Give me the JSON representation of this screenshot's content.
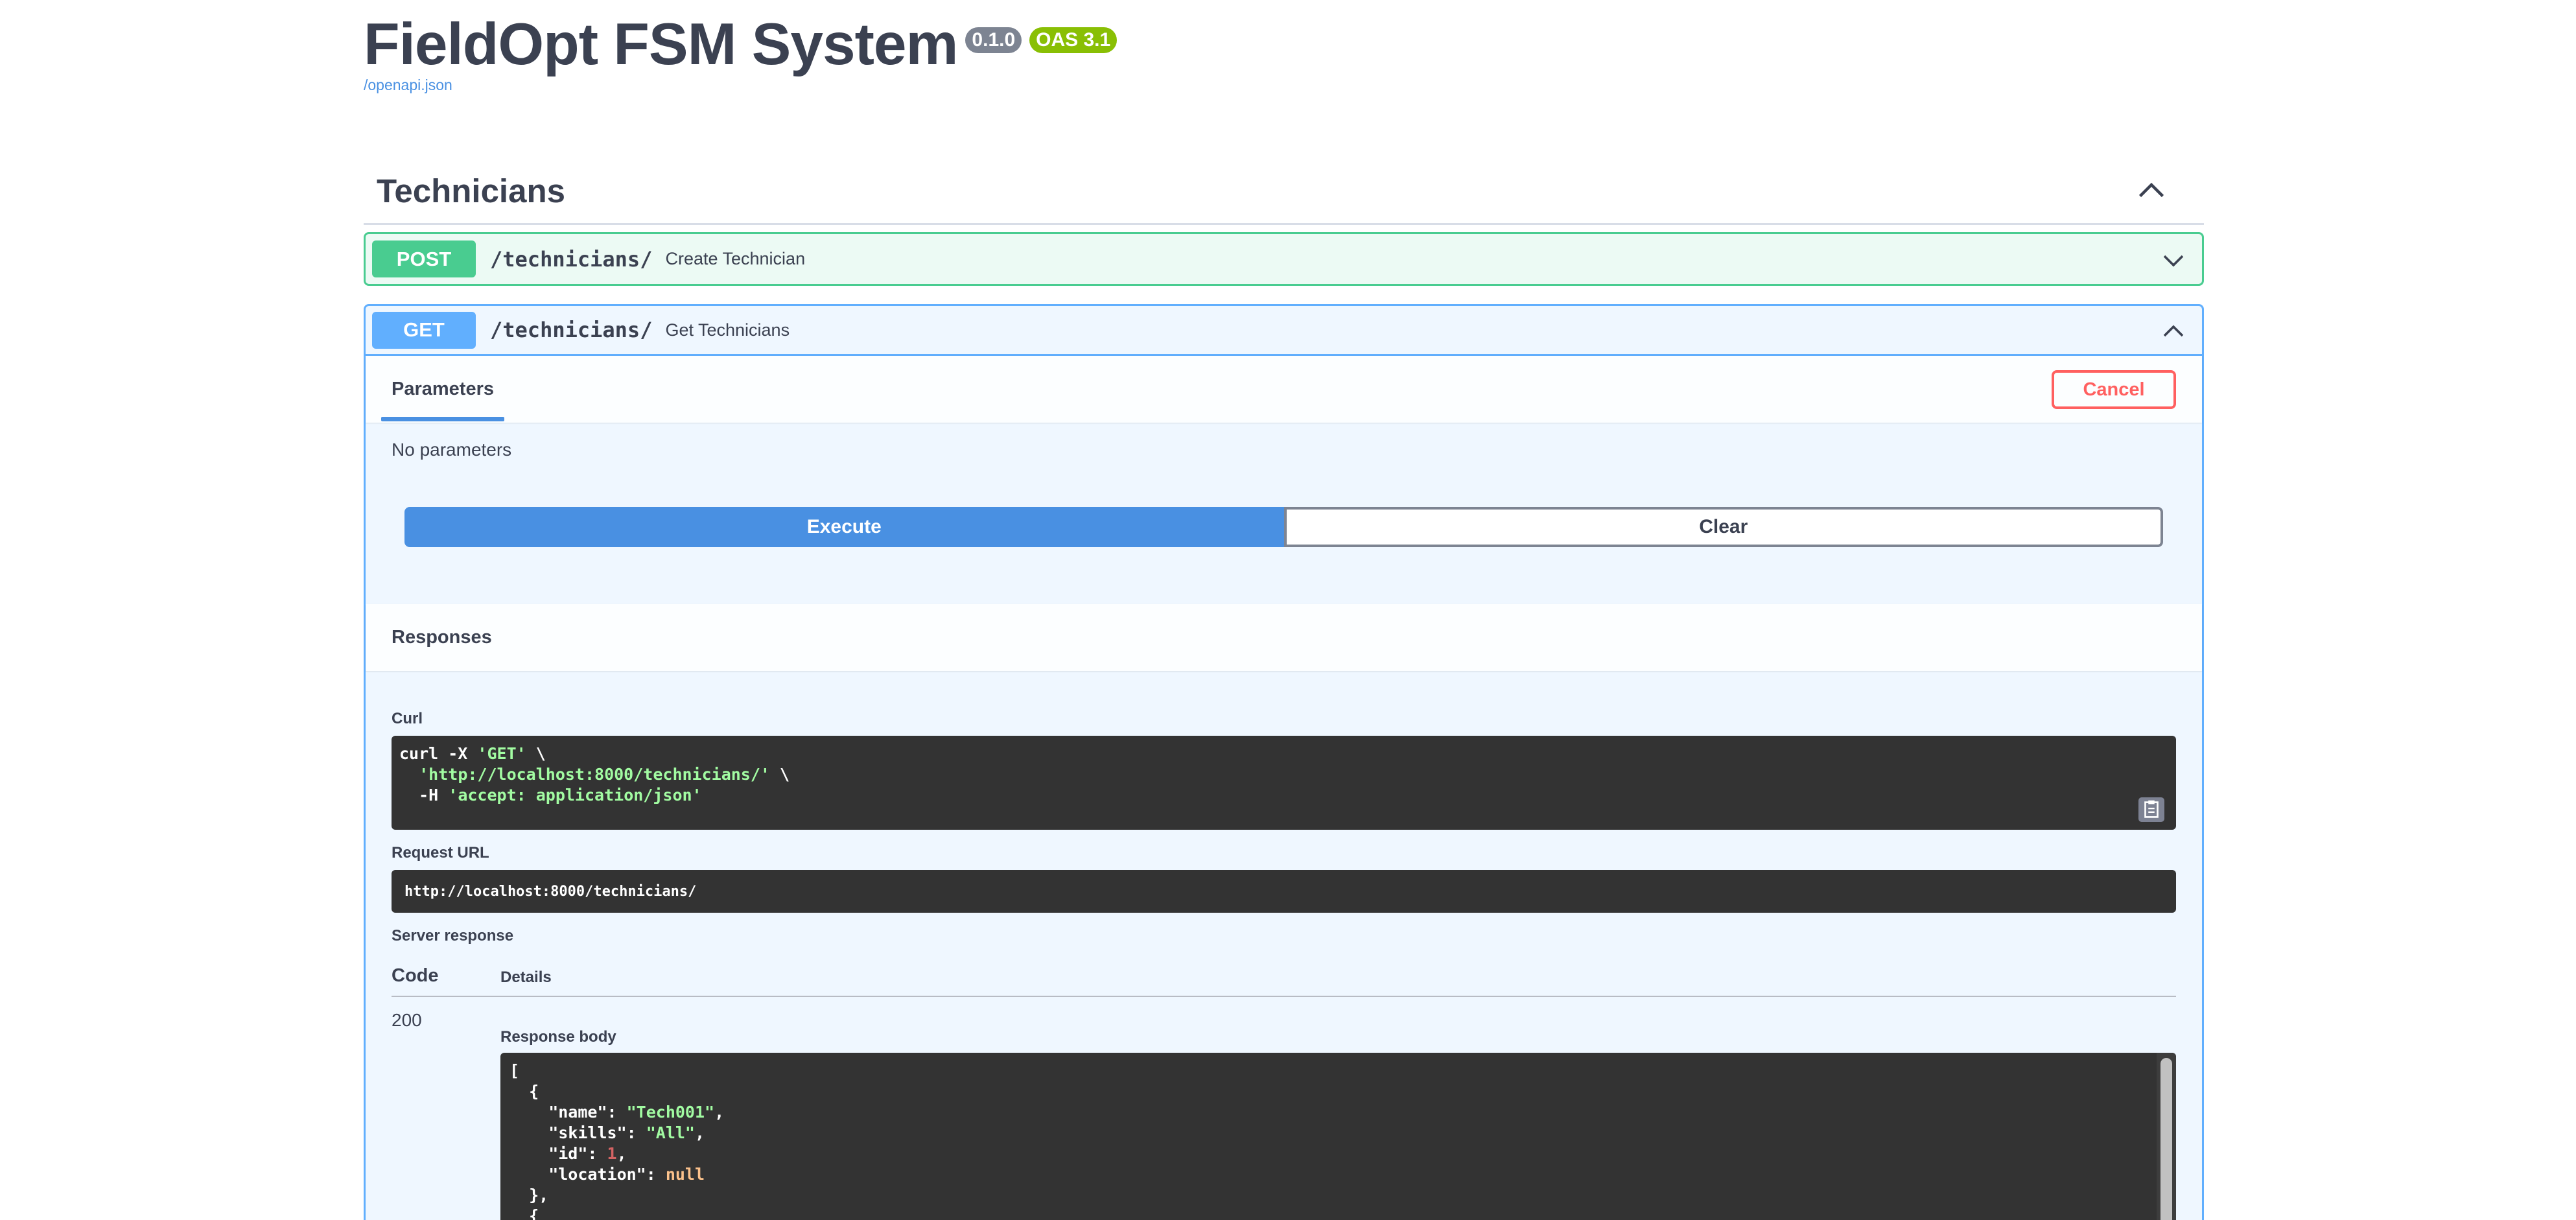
{
  "info": {
    "title": "FieldOpt FSM System",
    "version_badge": "0.1.0",
    "oas_badge": "OAS 3.1",
    "spec_link": "/openapi.json"
  },
  "tag": {
    "name": "Technicians",
    "expanded": true
  },
  "operations": [
    {
      "method": "POST",
      "path": "/technicians/",
      "summary": "Create Technician",
      "expanded": false,
      "color": "#49cc90"
    },
    {
      "method": "GET",
      "path": "/technicians/",
      "summary": "Get Technicians",
      "expanded": true,
      "color": "#61affe"
    }
  ],
  "get_panel": {
    "parameters_tab": "Parameters",
    "cancel_label": "Cancel",
    "no_parameters": "No parameters",
    "execute_label": "Execute",
    "clear_label": "Clear",
    "responses_title": "Responses",
    "curl_label": "Curl",
    "curl_lines": {
      "l1_cmd": "curl -X ",
      "l1_str": "'GET'",
      "l1_tail": " \\",
      "l2_indent": "  ",
      "l2_str": "'http://localhost:8000/technicians/'",
      "l2_tail": " \\",
      "l3_cmd": "  -H ",
      "l3_str": "'accept: application/json'"
    },
    "request_url_label": "Request URL",
    "request_url": "http://localhost:8000/technicians/",
    "server_response_label": "Server response",
    "code_header": "Code",
    "details_header": "Details",
    "response_code": "200",
    "response_body_label": "Response body",
    "response_body": {
      "open_bracket": "[",
      "open_brace": "  {",
      "name_key": "    \"name\": ",
      "name_val": "\"Tech001\"",
      "skills_key": "    \"skills\": ",
      "skills_val": "\"All\"",
      "id_key": "    \"id\": ",
      "id_val": "1",
      "location_key": "    \"location\": ",
      "location_val": "null",
      "close_brace": "  },",
      "next_brace": "  {"
    }
  },
  "colors": {
    "post": "#49cc90",
    "get": "#61affe",
    "execute": "#4990e2",
    "cancel": "#ff6060",
    "code_bg": "#333333",
    "string": "#a2fca2"
  }
}
